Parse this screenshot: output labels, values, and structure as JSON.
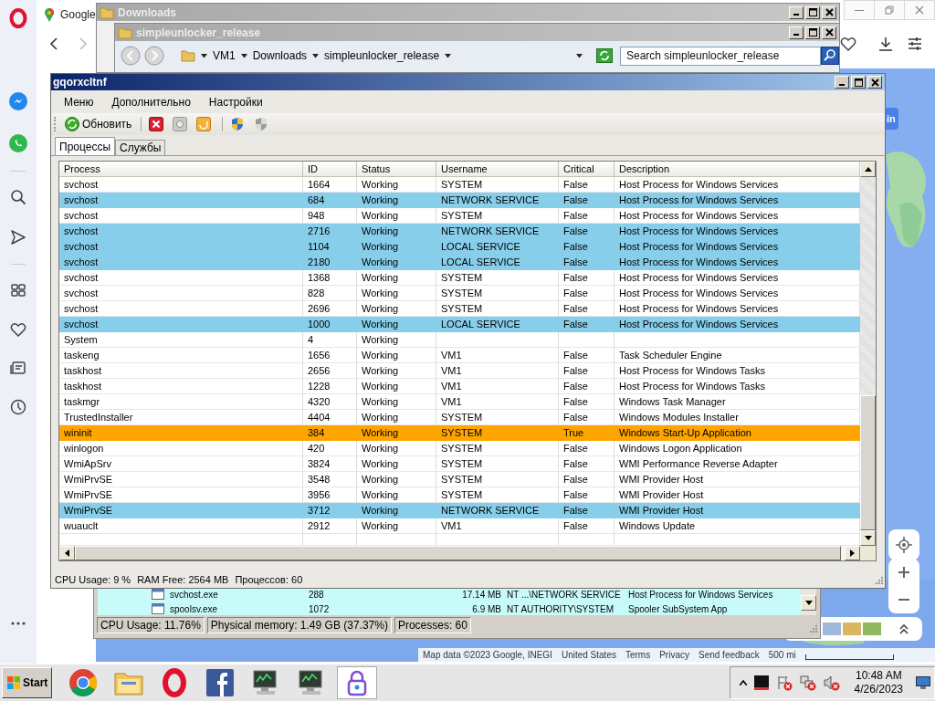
{
  "browser": {
    "tab_title": "Google"
  },
  "map": {
    "button": "in",
    "attribution": [
      "Map data ©2023 Google, INEGI",
      "United States",
      "Terms",
      "Privacy",
      "Send feedback"
    ],
    "scale": "500 mi"
  },
  "downloads_window": {
    "title": "Downloads"
  },
  "explorer_window": {
    "title": "simpleunlocker_release",
    "breadcrumb": [
      "VM1",
      "Downloads",
      "simpleunlocker_release"
    ],
    "search": {
      "placeholder": "Search simpleunlocker_release"
    }
  },
  "task_manager": {
    "rows": [
      {
        "name": "svchost.exe",
        "pid": "288",
        "memory": "17.14 MB",
        "user": "NT ...\\NETWORK SERVICE",
        "description": "Host Process for Windows Services"
      },
      {
        "name": "spoolsv.exe",
        "pid": "1072",
        "memory": "6.9 MB",
        "user": "NT AUTHORITY\\SYSTEM",
        "description": "Spooler SubSystem App"
      }
    ],
    "status_bar": [
      "CPU Usage: 11.76%",
      "Physical memory: 1.49 GB (37.37%)",
      "Processes: 60"
    ]
  },
  "window": {
    "title": "gqorxcltnf",
    "menu": [
      "Меню",
      "Дополнительно",
      "Настройки"
    ],
    "toolbar": {
      "refresh": "Обновить"
    },
    "tabs": [
      {
        "label": "Процессы",
        "selected": true
      },
      {
        "label": "Службы",
        "selected": false
      }
    ],
    "table": {
      "columns": [
        "Process",
        "ID",
        "Status",
        "Username",
        "Critical",
        "Description"
      ],
      "rows": [
        {
          "process": "svchost",
          "id": "1664",
          "status": "Working",
          "username": "SYSTEM",
          "critical": "False",
          "description": "Host Process for Windows Services"
        },
        {
          "process": "svchost",
          "id": "684",
          "status": "Working",
          "username": "NETWORK SERVICE",
          "critical": "False",
          "description": "Host Process for Windows Services",
          "color": "#87ceeb"
        },
        {
          "process": "svchost",
          "id": "948",
          "status": "Working",
          "username": "SYSTEM",
          "critical": "False",
          "description": "Host Process for Windows Services"
        },
        {
          "process": "svchost",
          "id": "2716",
          "status": "Working",
          "username": "NETWORK SERVICE",
          "critical": "False",
          "description": "Host Process for Windows Services",
          "color": "#87ceeb"
        },
        {
          "process": "svchost",
          "id": "1104",
          "status": "Working",
          "username": "LOCAL SERVICE",
          "critical": "False",
          "description": "Host Process for Windows Services",
          "color": "#87ceeb"
        },
        {
          "process": "svchost",
          "id": "2180",
          "status": "Working",
          "username": "LOCAL SERVICE",
          "critical": "False",
          "description": "Host Process for Windows Services",
          "color": "#87ceeb"
        },
        {
          "process": "svchost",
          "id": "1368",
          "status": "Working",
          "username": "SYSTEM",
          "critical": "False",
          "description": "Host Process for Windows Services"
        },
        {
          "process": "svchost",
          "id": "828",
          "status": "Working",
          "username": "SYSTEM",
          "critical": "False",
          "description": "Host Process for Windows Services"
        },
        {
          "process": "svchost",
          "id": "2696",
          "status": "Working",
          "username": "SYSTEM",
          "critical": "False",
          "description": "Host Process for Windows Services"
        },
        {
          "process": "svchost",
          "id": "1000",
          "status": "Working",
          "username": "LOCAL SERVICE",
          "critical": "False",
          "description": "Host Process for Windows Services",
          "color": "#87ceeb"
        },
        {
          "process": "System",
          "id": "4",
          "status": "Working"
        },
        {
          "process": "taskeng",
          "id": "1656",
          "status": "Working",
          "username": "VM1",
          "critical": "False",
          "description": "Task Scheduler Engine"
        },
        {
          "process": "taskhost",
          "id": "2656",
          "status": "Working",
          "username": "VM1",
          "critical": "False",
          "description": "Host Process for Windows Tasks"
        },
        {
          "process": "taskhost",
          "id": "1228",
          "status": "Working",
          "username": "VM1",
          "critical": "False",
          "description": "Host Process for Windows Tasks"
        },
        {
          "process": "taskmgr",
          "id": "4320",
          "status": "Working",
          "username": "VM1",
          "critical": "False",
          "description": "Windows Task Manager"
        },
        {
          "process": "TrustedInstaller",
          "id": "4404",
          "status": "Working",
          "username": "SYSTEM",
          "critical": "False",
          "description": "Windows Modules Installer"
        },
        {
          "process": "wininit",
          "id": "384",
          "status": "Working",
          "username": "SYSTEM",
          "critical": "True",
          "description": "Windows Start-Up Application",
          "color": "#ffa500"
        },
        {
          "process": "winlogon",
          "id": "420",
          "status": "Working",
          "username": "SYSTEM",
          "critical": "False",
          "description": "Windows Logon Application"
        },
        {
          "process": "WmiApSrv",
          "id": "3824",
          "status": "Working",
          "username": "SYSTEM",
          "critical": "False",
          "description": "WMI Performance Reverse Adapter"
        },
        {
          "process": "WmiPrvSE",
          "id": "3548",
          "status": "Working",
          "username": "SYSTEM",
          "critical": "False",
          "description": "WMI Provider Host"
        },
        {
          "process": "WmiPrvSE",
          "id": "3956",
          "status": "Working",
          "username": "SYSTEM",
          "critical": "False",
          "description": "WMI Provider Host"
        },
        {
          "process": "WmiPrvSE",
          "id": "3712",
          "status": "Working",
          "username": "NETWORK SERVICE",
          "critical": "False",
          "description": "WMI Provider Host",
          "color": "#87ceeb"
        },
        {
          "process": "wuauclt",
          "id": "2912",
          "status": "Working",
          "username": "VM1",
          "critical": "False",
          "description": "Windows Update"
        }
      ]
    },
    "status_bar": [
      "CPU Usage: 9 %",
      "RAM Free: 2564 MB",
      "Процессов: 60"
    ]
  },
  "taskbar": {
    "start": "Start",
    "time": "10:48 AM",
    "date": "4/26/2023"
  }
}
